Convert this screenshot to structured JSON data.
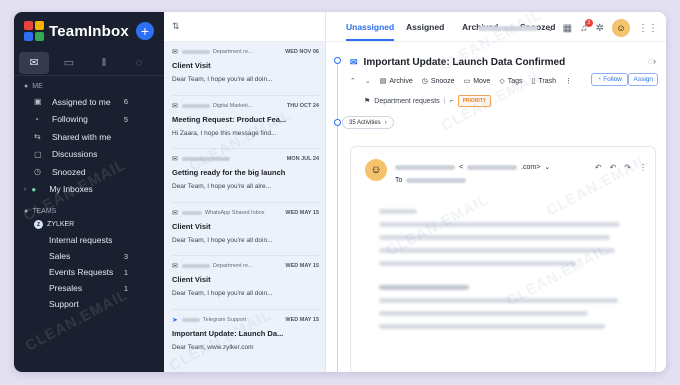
{
  "app": {
    "name": "TeamInbox"
  },
  "colors": {
    "accent": "#2d6ff2",
    "sidebar_bg": "#1a2030",
    "list_bg": "#edf2fa",
    "priority": "#e57f1f"
  },
  "sidebar": {
    "icons": [
      "inbox-icon",
      "contacts-icon",
      "reports-icon",
      "chat-icon"
    ],
    "me_label": "ME",
    "me_items": [
      {
        "label": "Assigned to me",
        "count": "6",
        "icon": "inbox-icon"
      },
      {
        "label": "Following",
        "count": "5",
        "icon": "bell-icon"
      },
      {
        "label": "Shared with me",
        "count": "",
        "icon": "share-icon"
      },
      {
        "label": "Discussions",
        "count": "",
        "icon": "chat-icon"
      },
      {
        "label": "Snoozed",
        "count": "",
        "icon": "clock-icon"
      },
      {
        "label": "My Inboxes",
        "count": "",
        "icon": "inbox-icon"
      }
    ],
    "teams_label": "TEAMS",
    "org_label": "ZYLKER",
    "team_items": [
      {
        "label": "Internal requests",
        "count": ""
      },
      {
        "label": "Sales",
        "count": "3"
      },
      {
        "label": "Events Requests",
        "count": "1"
      },
      {
        "label": "Presales",
        "count": "1"
      },
      {
        "label": "Support",
        "count": ""
      }
    ]
  },
  "tabs": [
    "Unassigned",
    "Assigned",
    "Archived",
    "Snoozed"
  ],
  "notifications": {
    "count": "3"
  },
  "mail_list": [
    {
      "tag": "Department re...",
      "date": "WED NOV 06",
      "subject": "Client Visit",
      "preview": "Dear Team, I hope you're all doin..."
    },
    {
      "tag": "Digital Marketi...",
      "date": "THU OCT 24",
      "subject": "Meeting Request: Product Fea...",
      "preview": "Hi Zaara, I hope this message find..."
    },
    {
      "tag": "",
      "date": "MON JUL 24",
      "subject": "Getting ready for the big launch",
      "preview": "Dear Team, I hope you're all alre..."
    },
    {
      "tag": "WhatsApp Shared Inbox",
      "date": "WED MAY 15",
      "subject": "Client Visit",
      "preview": "Dear Team, I hope you're all doin..."
    },
    {
      "tag": "Department re...",
      "date": "WED MAY 15",
      "subject": "Client Visit",
      "preview": "Dear Team, I hope you're all doin..."
    },
    {
      "tag": "Telegram Support",
      "date": "WED MAY 15",
      "subject": "Important Update: Launch Da...",
      "preview": "Dear Team, www.zylker.com"
    }
  ],
  "detail": {
    "subject": "Important Update: Launch Data Confirmed",
    "toolbar": [
      "Archive",
      "Snooze",
      "Move",
      "Tags",
      "Trash"
    ],
    "follow_label": "Follow",
    "assign_label": "Assign",
    "department": "Department requests",
    "priority": "PRIORITY",
    "activities": "35 Activities",
    "to_label": "To",
    "from_domain": ".com>"
  },
  "watermark": "CLEAN.EMAIL"
}
